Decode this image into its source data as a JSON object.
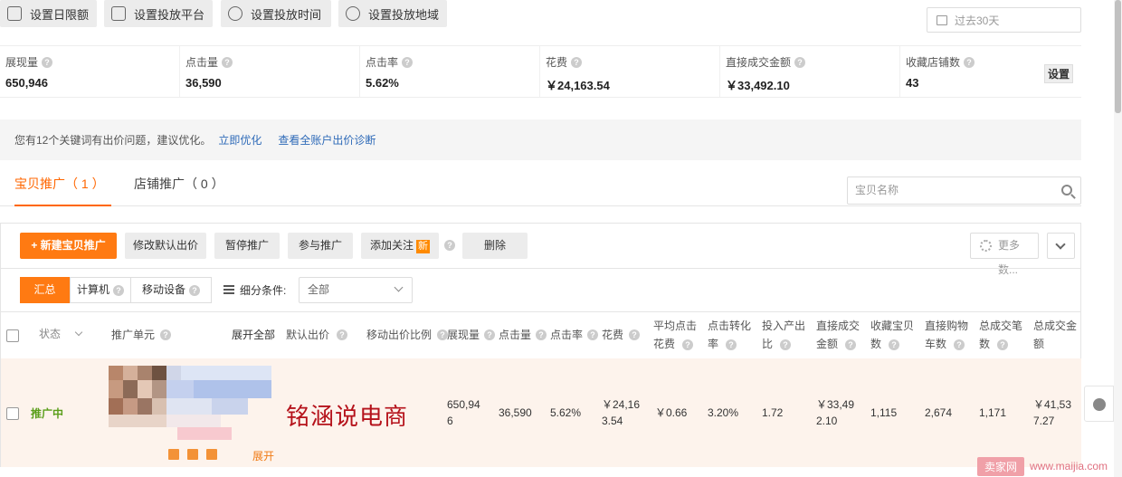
{
  "top_buttons": [
    "设置日限额",
    "设置投放平台",
    "设置投放时间",
    "设置投放地域"
  ],
  "date_range": "过去30天",
  "metrics": [
    {
      "label": "展现量",
      "value": "650,946"
    },
    {
      "label": "点击量",
      "value": "36,590"
    },
    {
      "label": "点击率",
      "value": "5.62%"
    },
    {
      "label": "花费",
      "value": "￥24,163.54"
    },
    {
      "label": "直接成交金额",
      "value": "￥33,492.10"
    },
    {
      "label": "收藏店铺数",
      "value": "43"
    }
  ],
  "settings_label": "设置",
  "notice": {
    "text": "您有12个关键词有出价问题，建议优化。",
    "link1": "立即优化",
    "link2": "查看全账户出价诊断"
  },
  "tabs": [
    {
      "label": "宝贝推广（ 1 ）",
      "active": true
    },
    {
      "label": "店铺推广（ 0 ）",
      "active": false
    }
  ],
  "search_placeholder": "宝贝名称",
  "toolbar": {
    "new": "+ 新建宝贝推广",
    "modify_bid": "修改默认出价",
    "pause": "暂停推广",
    "join": "参与推广",
    "follow": "添加关注",
    "new_badge": "新",
    "delete": "删除",
    "more": "更多数..."
  },
  "filters": {
    "segments": [
      "汇总",
      "计算机",
      "移动设备"
    ],
    "condition_label": "细分条件:",
    "condition_value": "全部"
  },
  "table": {
    "headers": {
      "status": "状态",
      "unit": "推广单元",
      "expand_all": "展开全部",
      "default_bid": "默认出价",
      "mobile_ratio": "移动出价比例",
      "impressions": "展现量",
      "clicks": "点击量",
      "ctr": "点击率",
      "cost": "花费",
      "avg_cpc_1": "平均点击",
      "avg_cpc_2": "花费",
      "cvr_1": "点击转化",
      "cvr_2": "率",
      "roi_1": "投入产出",
      "roi_2": "比",
      "direct_amt_1": "直接成交",
      "direct_amt_2": "金额",
      "fav_item_1": "收藏宝贝",
      "fav_item_2": "数",
      "cart_1": "直接购物",
      "cart_2": "车数",
      "orders_1": "总成交笔",
      "orders_2": "数",
      "total_amt_1": "总成交金",
      "total_amt_2": "额"
    },
    "row": {
      "status": "推广中",
      "impressions_1": "650,94",
      "impressions_2": "6",
      "clicks": "36,590",
      "ctr": "5.62%",
      "cost_1": "￥24,16",
      "cost_2": "3.54",
      "avg_cpc": "￥0.66",
      "cvr": "3.20%",
      "roi": "1.72",
      "direct_amt_1": "￥33,49",
      "direct_amt_2": "2.10",
      "fav_item": "1,115",
      "cart": "2,674",
      "orders": "1,171",
      "total_amt_1": "￥41,53",
      "total_amt_2": "7.27",
      "expand": "展开"
    }
  },
  "watermark": "铭涵说电商",
  "brand_box": "卖家网",
  "brand_url": "www.maijia.com"
}
